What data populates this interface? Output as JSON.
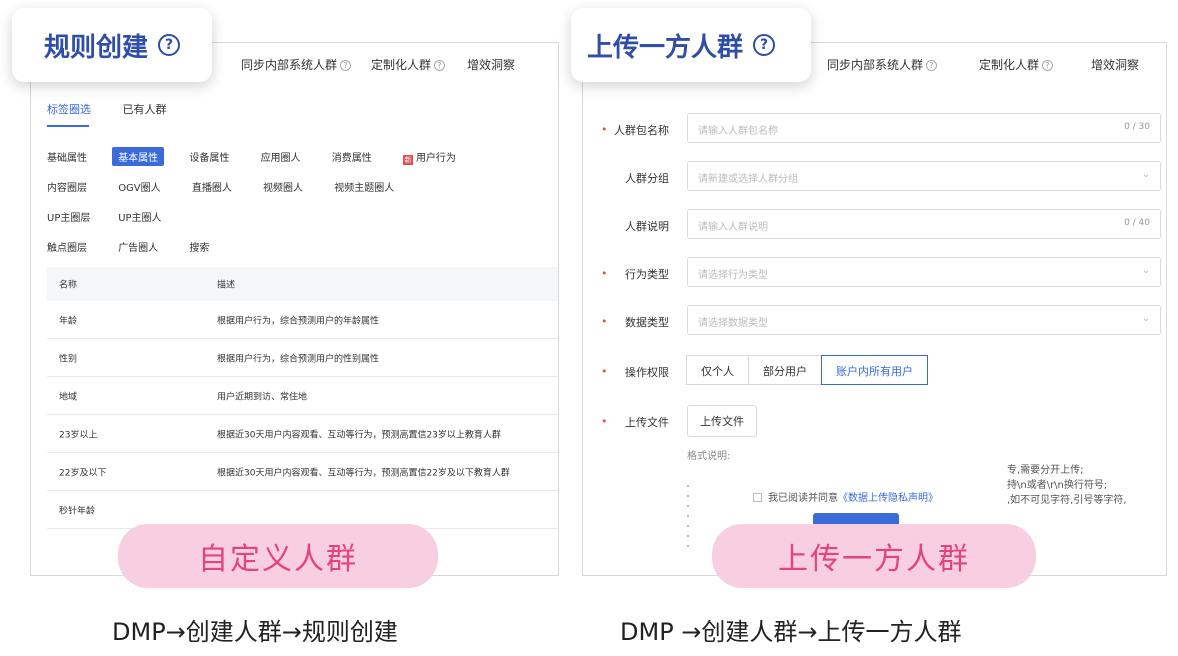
{
  "left": {
    "title": "规则创建",
    "nav": [
      "同步内部系统人群",
      "定制化人群",
      "增效洞察"
    ],
    "tabs": [
      "标签圈选",
      "已有人群"
    ],
    "filters": [
      {
        "label": "基础属性",
        "options": [
          "基本属性",
          "设备属性",
          "应用圈人",
          "消费属性",
          "用户行为"
        ],
        "active": 0
      },
      {
        "label": "内容圈层",
        "options": [
          "OGV圈人",
          "直播圈人",
          "视频圈人",
          "视频主题圈人"
        ]
      },
      {
        "label": "UP主圈层",
        "options": [
          "UP主圈人"
        ]
      },
      {
        "label": "触点圈层",
        "options": [
          "广告圈人",
          "搜索"
        ]
      }
    ],
    "table": {
      "headers": [
        "名称",
        "描述"
      ],
      "rows": [
        [
          "年龄",
          "根据用户行为，综合预测用户的年龄属性"
        ],
        [
          "性别",
          "根据用户行为，综合预测用户的性别属性"
        ],
        [
          "地域",
          "用户近期到访、常住地"
        ],
        [
          "23岁以上",
          "根据近30天用户内容观看、互动等行为，预测高置信23岁以上教育人群"
        ],
        [
          "22岁及以下",
          "根据近30天用户内容观看、互动等行为，预测高置信22岁及以下教育人群"
        ],
        [
          "秒针年龄",
          ""
        ]
      ]
    },
    "pill": "自定义人群",
    "caption": "DMP→创建人群→规则创建"
  },
  "right": {
    "title": "上传一方人群",
    "nav": [
      "同步内部系统人群",
      "定制化人群",
      "增效洞察"
    ],
    "form": {
      "name_label": "人群包名称",
      "name_placeholder": "请输入人群包名称",
      "name_count": "0 / 30",
      "group_label": "人群分组",
      "group_placeholder": "请新建或选择人群分组",
      "desc_label": "人群说明",
      "desc_placeholder": "请输入人群说明",
      "desc_count": "0 / 40",
      "behavior_label": "行为类型",
      "behavior_placeholder": "请选择行为类型",
      "datatype_label": "数据类型",
      "datatype_placeholder": "请选择数据类型",
      "perm_label": "操作权限",
      "perm_options": [
        "仅个人",
        "部分用户",
        "账户内所有用户"
      ],
      "upload_label": "上传文件",
      "upload_button": "上传文件",
      "format_label": "格式说明:",
      "format_notes": [
        "专,需要分开上传;",
        "持\\n或者\\r\\n换行符号;",
        ",如不可见字符,引号等字符,"
      ],
      "agree_text": "我已阅读并同意",
      "agree_link": "《数据上传隐私声明》"
    },
    "pill": "上传一方人群",
    "caption": "DMP →创建人群→上传一方人群"
  }
}
